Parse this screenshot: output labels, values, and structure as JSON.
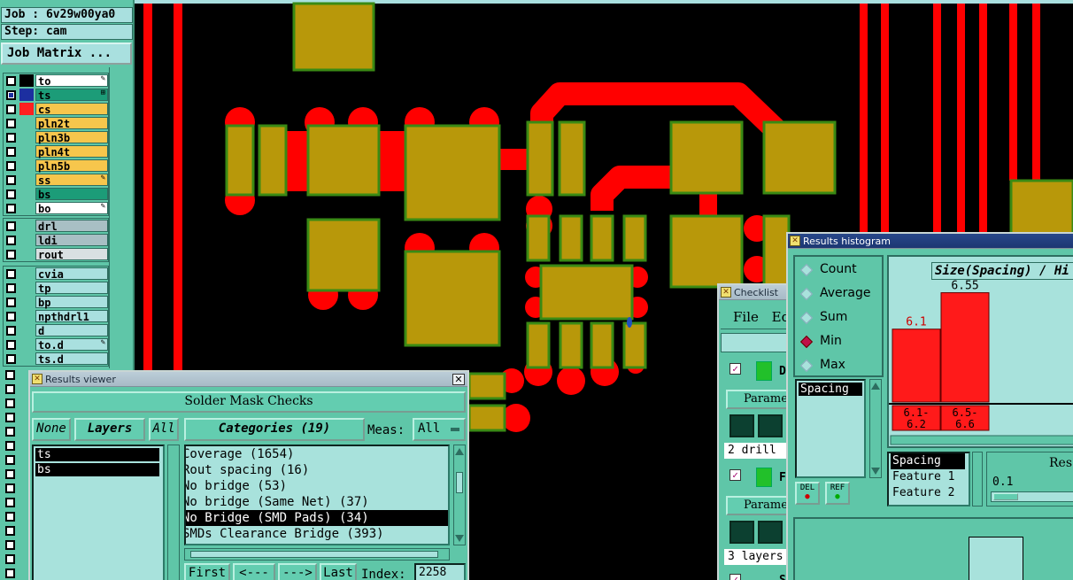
{
  "job": {
    "label": "Job :",
    "value": "6v29w00ya0",
    "step_label": "Step:",
    "step_value": "cam",
    "matrix_button": "Job Matrix ..."
  },
  "layers": {
    "board": [
      {
        "name": "to",
        "color": "#ffffff",
        "swatch": "#000000",
        "pen": true
      },
      {
        "name": "ts",
        "color": "#1c9c78",
        "swatch": "#2a8c30",
        "pen": false,
        "selected": true
      },
      {
        "name": "cs",
        "color": "#f7c64c",
        "swatch": "#ff2020",
        "pen": false
      },
      {
        "name": "pln2t",
        "color": "#f7c64c",
        "swatch": "#5fc6a8",
        "pen": false
      },
      {
        "name": "pln3b",
        "color": "#f7c64c",
        "swatch": "#5fc6a8",
        "pen": false
      },
      {
        "name": "pln4t",
        "color": "#f7c64c",
        "swatch": "#5fc6a8",
        "pen": false
      },
      {
        "name": "pln5b",
        "color": "#f7c64c",
        "swatch": "#5fc6a8",
        "pen": false
      },
      {
        "name": "ss",
        "color": "#f7c64c",
        "swatch": "#5fc6a8",
        "pen": true
      },
      {
        "name": "bs",
        "color": "#1c9c78",
        "swatch": "#5fc6a8",
        "pen": false
      },
      {
        "name": "bo",
        "color": "#ffffff",
        "swatch": "#5fc6a8",
        "pen": true
      }
    ],
    "drill": [
      {
        "name": "drl",
        "color": "#a8bfc4",
        "swatch": "#5fc6a8",
        "pen": false
      },
      {
        "name": "ldi",
        "color": "#a8bfc4",
        "swatch": "#5fc6a8",
        "pen": false
      },
      {
        "name": "rout",
        "color": "#d9e0e2",
        "swatch": "#5fc6a8",
        "pen": false
      }
    ],
    "misc": [
      {
        "name": "cvia",
        "color": "#a9e0df",
        "swatch": "#5fc6a8",
        "pen": false
      },
      {
        "name": "tp",
        "color": "#a9e0df",
        "swatch": "#5fc6a8",
        "pen": false
      },
      {
        "name": "bp",
        "color": "#a9e0df",
        "swatch": "#5fc6a8",
        "pen": false
      },
      {
        "name": "npthdrl1",
        "color": "#a9e0df",
        "swatch": "#5fc6a8",
        "pen": false
      },
      {
        "name": "d",
        "color": "#a9e0df",
        "swatch": "#5fc6a8",
        "pen": false
      },
      {
        "name": "to.d",
        "color": "#a9e0df",
        "swatch": "#5fc6a8",
        "pen": true
      },
      {
        "name": "ts.d",
        "color": "#a9e0df",
        "swatch": "#5fc6a8",
        "pen": false
      }
    ]
  },
  "results_viewer": {
    "title": "Results viewer",
    "heading": "Solder Mask Checks",
    "none_btn": "None",
    "layers_btn": "Layers",
    "all_btn": "All",
    "categories_btn": "Categories (19)",
    "meas_label": "Meas:",
    "meas_value": "All",
    "layer_list": [
      "ts",
      "bs"
    ],
    "categories": [
      "Coverage (1654)",
      "Rout spacing (16)",
      "No bridge (53)",
      "No bridge (Same Net) (37)",
      "No Bridge (SMD Pads) (34)",
      "SMDs Clearance Bridge (393)"
    ],
    "selected_category": 4,
    "first_btn": "First",
    "prev_btn": "<---",
    "next_btn": "--->",
    "last_btn": "Last",
    "index_label": "Index:",
    "index_value": "2258"
  },
  "checklist": {
    "title": "Checklist",
    "menu_file": "File",
    "menu_edit": "Ed",
    "items": [
      {
        "letter": "D",
        "param": "Parame",
        "summary": "2 drill"
      },
      {
        "letter": "F",
        "param": "Parame",
        "summary": "3 layers"
      },
      {
        "letter": "S"
      }
    ]
  },
  "histogram": {
    "title": "Results histogram",
    "modes": [
      "Count",
      "Average",
      "Sum",
      "Min",
      "Max"
    ],
    "selected_mode": "Min",
    "measure_list": [
      "Spacing"
    ],
    "chart_title": "Size(Spacing) / Hi",
    "del_btn": "DEL",
    "ref_btn": "REF",
    "fields": [
      "Spacing",
      "Feature 1",
      "Feature 2"
    ],
    "res_label": "Res",
    "res_value": "0.1"
  },
  "chart_data": {
    "type": "bar",
    "title": "Size(Spacing) / Hi",
    "categories": [
      "6.1-6.2",
      "6.5-6.6"
    ],
    "values": [
      6.1,
      6.55
    ],
    "data_labels": [
      "6.1",
      "6.55"
    ],
    "category_labels": [
      [
        "6.1-",
        "6.2"
      ],
      [
        "6.5-",
        "6.6"
      ]
    ],
    "bar_color": "#ff1a1a"
  },
  "colors": {
    "pad": "#b8980a",
    "pad_outline": "#3a8a14",
    "trace": "#ff0000",
    "panel": "#5fc6a8",
    "field": "#a8e2dc"
  }
}
